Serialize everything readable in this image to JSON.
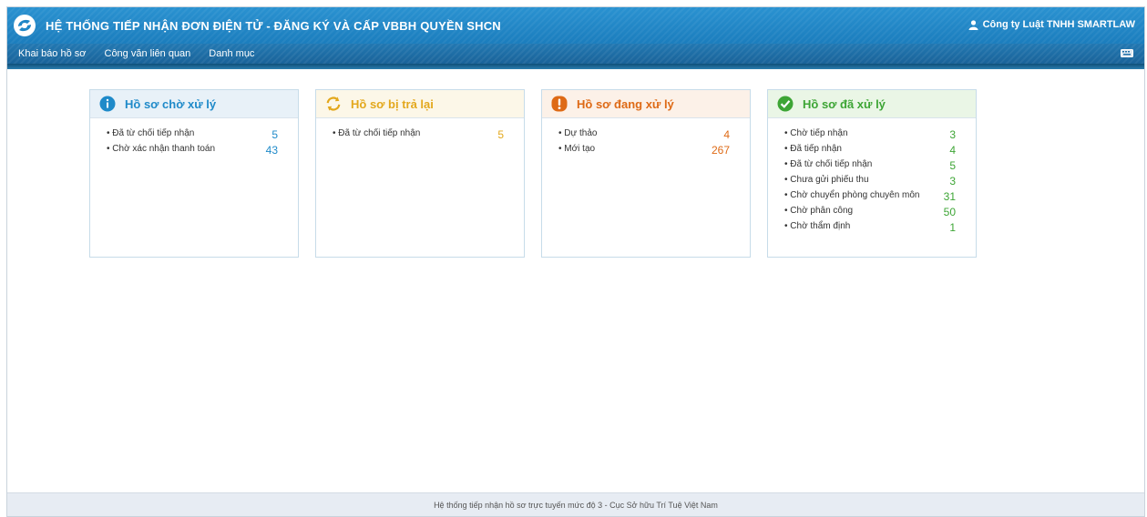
{
  "app": {
    "title": "HỆ THỐNG TIẾP NHẬN ĐƠN ĐIỆN TỬ - ĐĂNG KÝ VÀ CẤP VBBH QUYỀN SHCN",
    "user": "Công ty Luật TNHH SMARTLAW"
  },
  "menu": [
    "Khai báo hồ sơ",
    "Công văn liên quan",
    "Danh mục"
  ],
  "colors": {
    "pending": "#1f8ac9",
    "returned": "#e3a81d",
    "processing": "#de6a16",
    "done": "#3da535",
    "header": "#1f87c7"
  },
  "cards": [
    {
      "title": "Hồ sơ chờ xử lý",
      "icon": "info-icon",
      "rows": [
        {
          "label": "Đã từ chối tiếp nhận",
          "value": "5"
        },
        {
          "label": "Chờ xác nhận thanh toán",
          "value": "43"
        }
      ]
    },
    {
      "title": "Hồ sơ bị trả lại",
      "icon": "refresh-icon",
      "rows": [
        {
          "label": "Đã từ chối tiếp nhận",
          "value": "5"
        }
      ]
    },
    {
      "title": "Hồ sơ đang xử lý",
      "icon": "exclamation-icon",
      "rows": [
        {
          "label": "Dự thảo",
          "value": "4"
        },
        {
          "label": "Mới tạo",
          "value": "267"
        }
      ]
    },
    {
      "title": "Hồ sơ đã xử lý",
      "icon": "check-icon",
      "rows": [
        {
          "label": "Chờ tiếp nhận",
          "value": "3"
        },
        {
          "label": "Đã tiếp nhận",
          "value": "4"
        },
        {
          "label": "Đã từ chối tiếp nhận",
          "value": "5"
        },
        {
          "label": "Chưa gửi phiếu thu",
          "value": "3"
        },
        {
          "label": "Chờ chuyển phòng chuyên môn",
          "value": "31"
        },
        {
          "label": "Chờ phân công",
          "value": "50"
        },
        {
          "label": "Chờ thẩm định",
          "value": "1"
        }
      ]
    }
  ],
  "footer": "Hệ thống tiếp nhận hồ sơ trực tuyến mức độ 3 - Cục Sở hữu Trí Tuệ Việt Nam"
}
